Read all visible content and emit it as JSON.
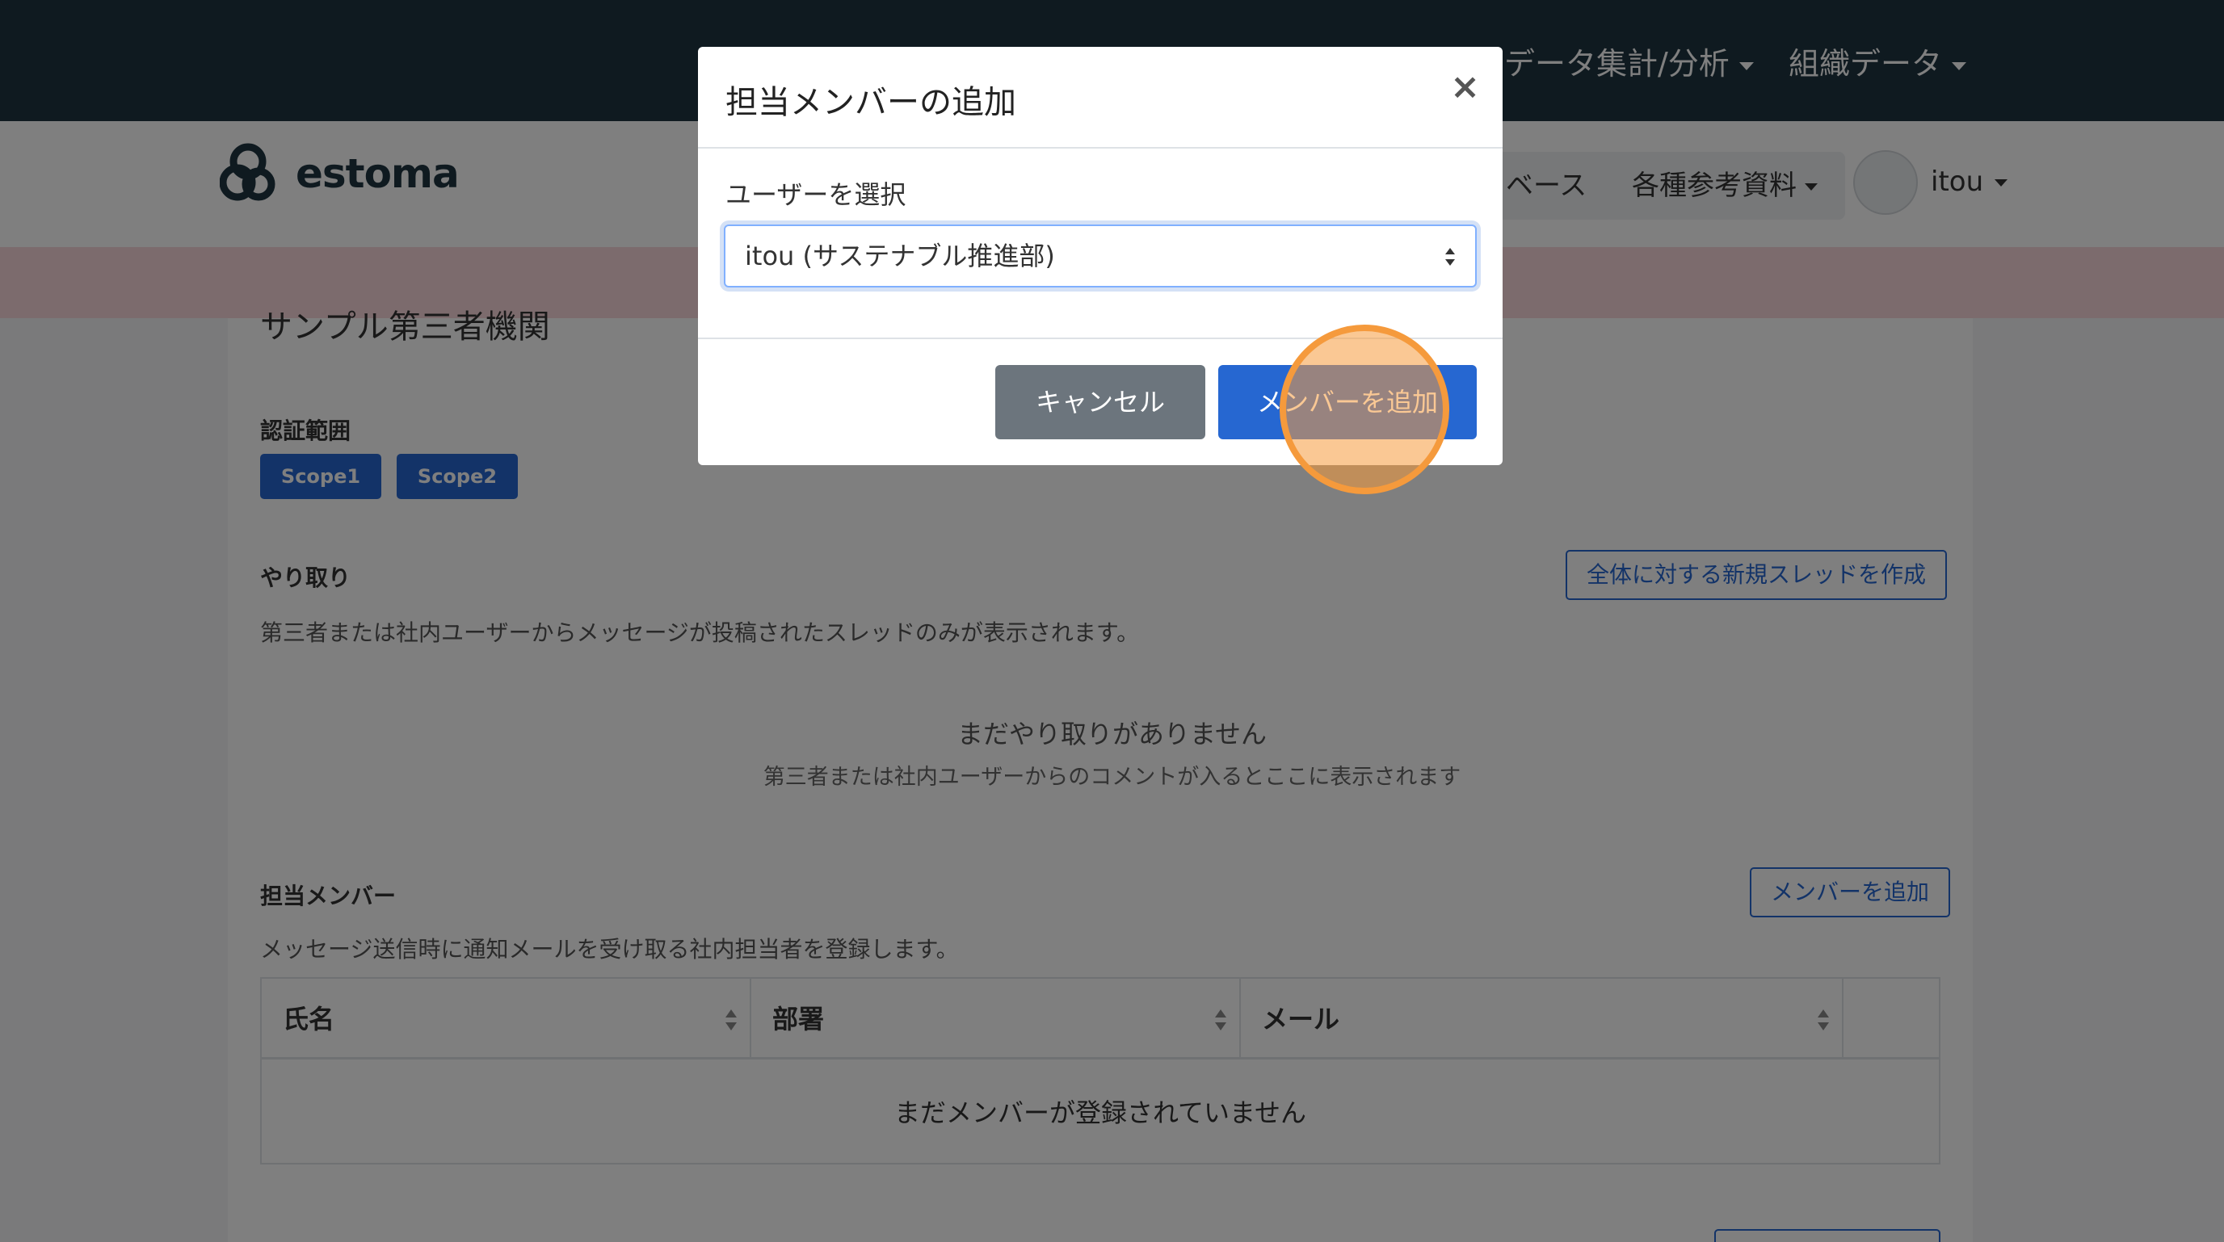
{
  "topnav": {
    "items": [
      {
        "label": "データ集計/分析"
      },
      {
        "label": "組織データ"
      }
    ]
  },
  "header": {
    "logo_text": "estoma",
    "partial_item": "ベース",
    "reference_label": "各種参考資料",
    "user_name": "itou"
  },
  "main": {
    "org_title": "サンプル第三者機関",
    "scope_section": {
      "title": "認証範囲",
      "badges": [
        "Scope1",
        "Scope2"
      ]
    },
    "threads_section": {
      "title": "やり取り",
      "new_thread_button": "全体に対する新規スレッドを作成",
      "description": "第三者または社内ユーザーからメッセージが投稿されたスレッドのみが表示されます。",
      "empty_title": "まだやり取りがありません",
      "empty_subtitle": "第三者または社内ユーザーからのコメントが入るとここに表示されます"
    },
    "members_section": {
      "title": "担当メンバー",
      "add_button": "メンバーを追加",
      "description": "メッセージ送信時に通知メールを受け取る社内担当者を登録します。",
      "columns": [
        "氏名",
        "部署",
        "メール"
      ],
      "empty_row": "まだメンバーが登録されていません"
    }
  },
  "modal": {
    "title": "担当メンバーの追加",
    "close": "×",
    "label": "ユーザーを選択",
    "selected_user": "itou (サステナブル推進部)",
    "cancel_label": "キャンセル",
    "add_label": "メンバーを追加"
  },
  "colors": {
    "navbar": "#1e3440",
    "primary": "#2667d1",
    "secondary": "#6c757d",
    "alert": "#f8d7da",
    "click_highlight": "#f59a3c"
  }
}
